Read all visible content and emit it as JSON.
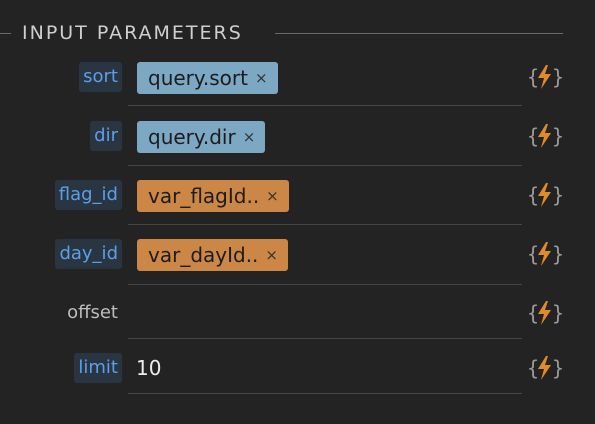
{
  "section": {
    "title": "INPUT PARAMETERS"
  },
  "params": [
    {
      "label": "sort",
      "value_type": "chip",
      "chip_color": "blue",
      "chip_text": "query.sort",
      "chip_close": "×"
    },
    {
      "label": "dir",
      "value_type": "chip",
      "chip_color": "blue",
      "chip_text": "query.dir",
      "chip_close": "×"
    },
    {
      "label": "flag_id",
      "value_type": "chip",
      "chip_color": "orange",
      "chip_text": "var_flagId..",
      "chip_close": "×"
    },
    {
      "label": "day_id",
      "value_type": "chip",
      "chip_color": "orange",
      "chip_text": "var_dayId..",
      "chip_close": "×"
    },
    {
      "label": "offset",
      "value_type": "empty",
      "value": ""
    },
    {
      "label": "limit",
      "value_type": "text",
      "value": "10"
    }
  ],
  "colors": {
    "background": "#232323",
    "label_linked": "#5d9eea",
    "chip_blue": "#7ca8c4",
    "chip_orange": "#cc8747",
    "dynamic_icon_bolt": "#e08a2c",
    "dynamic_icon_brace": "#9a9a9a"
  },
  "icons": {
    "dynamic_value": "lightning-braces-icon",
    "chip_remove": "close-icon"
  }
}
